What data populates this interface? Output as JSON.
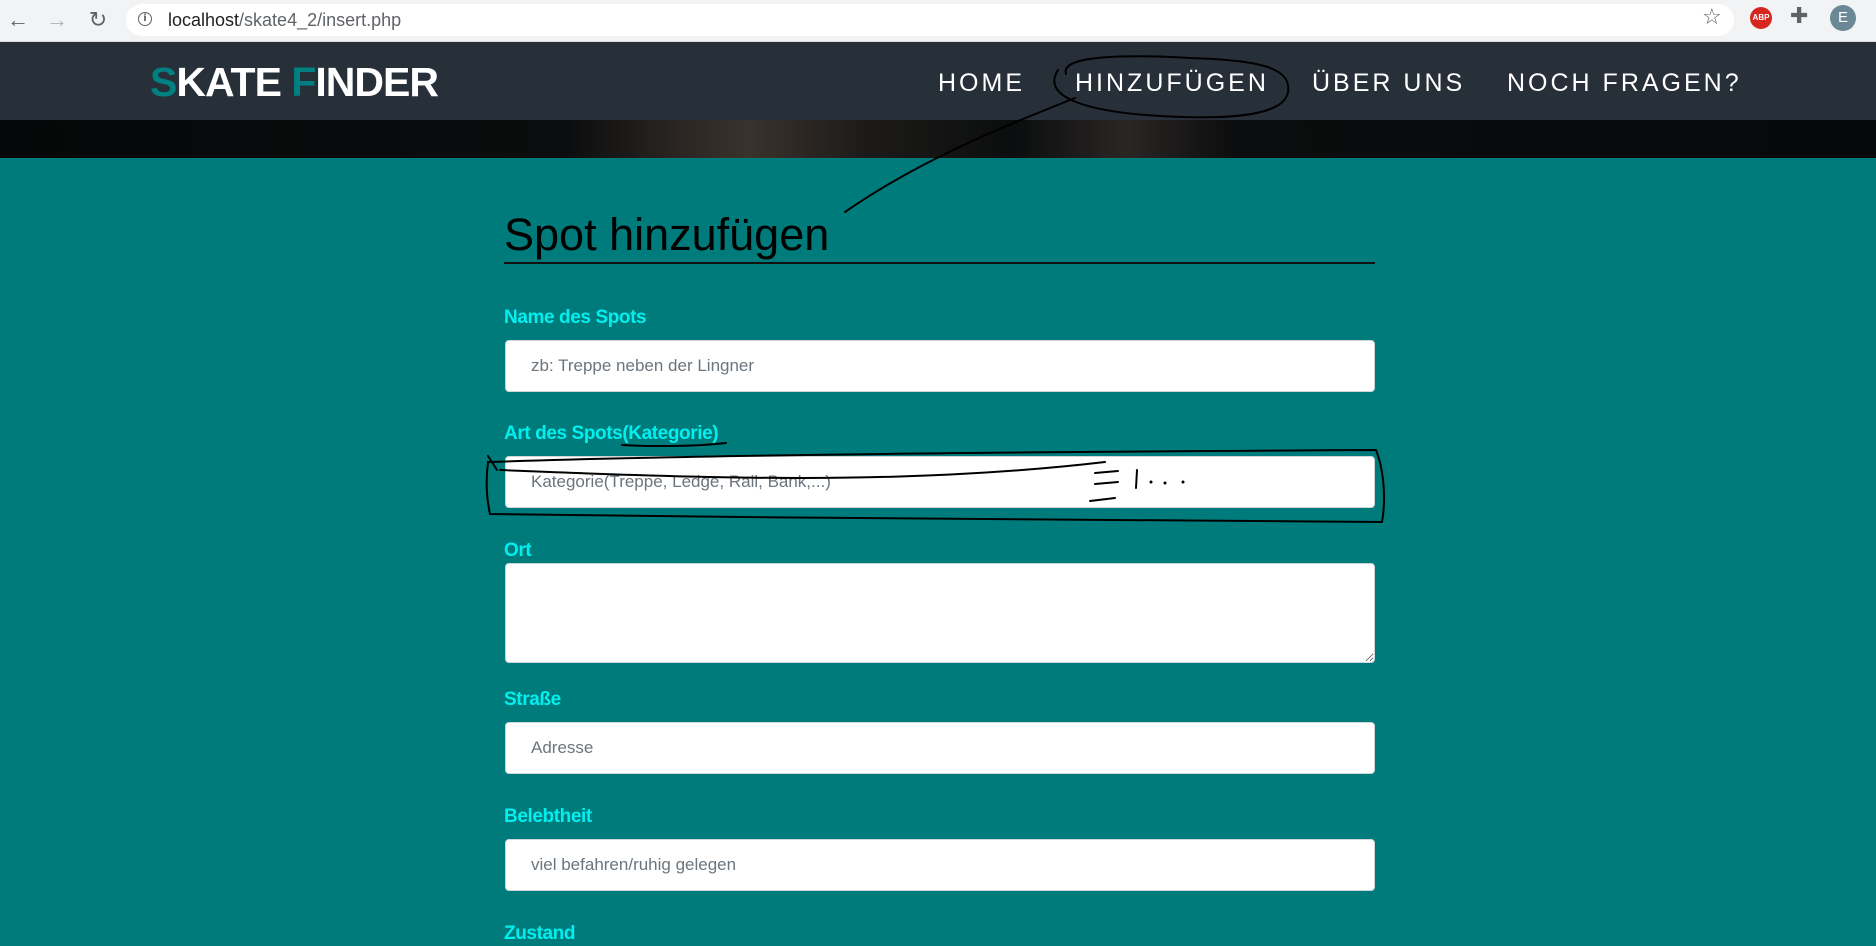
{
  "browser": {
    "url_host": "localhost",
    "url_path": "/skate4_2/insert.php",
    "profile_initial": "E",
    "adblock_label": "ABP",
    "icons": [
      "back-arrow-icon",
      "forward-arrow-icon",
      "reload-icon",
      "site-info-icon",
      "bookmark-star-icon",
      "adblock-icon",
      "extensions-puzzle-icon"
    ]
  },
  "logo": {
    "part1_accent": "S",
    "part1": "KATE ",
    "part2_accent": "F",
    "part2": "INDER"
  },
  "nav": {
    "home": "HOME",
    "add": "HINZUFÜGEN",
    "about": "ÜBER UNS",
    "questions": "NOCH FRAGEN?"
  },
  "form": {
    "title": "Spot hinzufügen",
    "name_label": "Name des Spots",
    "name_placeholder": "zb: Treppe neben der Lingner",
    "category_label": "Art des Spots(Kategorie)",
    "category_placeholder": "Kategorie(Treppe, Ledge, Rail, Bank,...)",
    "location_label": "Ort",
    "location_value": "",
    "street_label": "Straße",
    "street_placeholder": "Adresse",
    "busyness_label": "Belebtheit",
    "busyness_placeholder": "viel befahren/ruhig gelegen",
    "condition_label": "Zustand"
  },
  "colors": {
    "page_bg": "#007b7b",
    "header_bg": "#272f38",
    "logo_accent": "#008080",
    "label_color": "#00f0f0",
    "annotation_ink": "#000000"
  }
}
